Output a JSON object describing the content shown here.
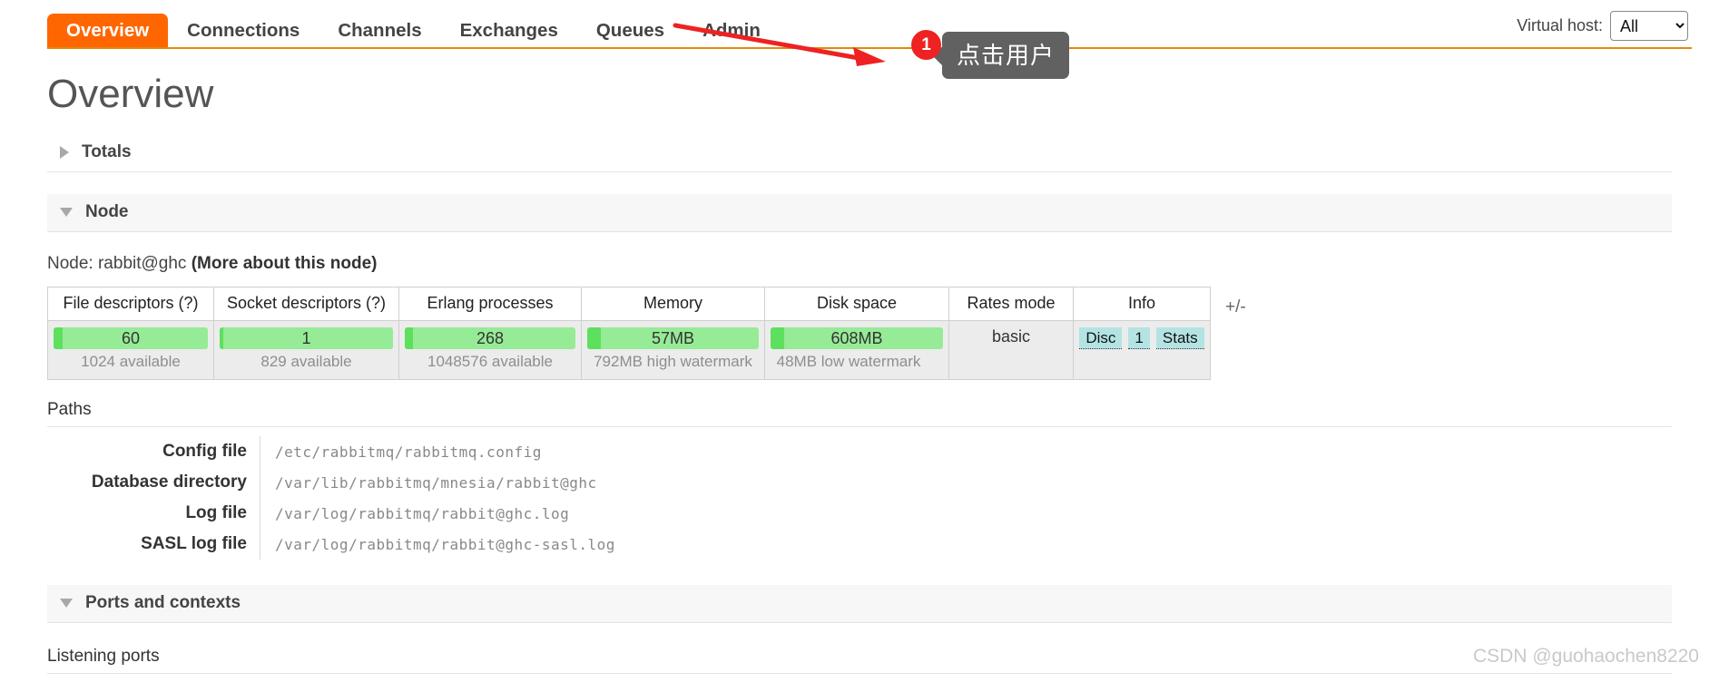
{
  "nav": {
    "tabs": [
      {
        "label": "Overview",
        "active": true
      },
      {
        "label": "Connections",
        "active": false
      },
      {
        "label": "Channels",
        "active": false
      },
      {
        "label": "Exchanges",
        "active": false
      },
      {
        "label": "Queues",
        "active": false
      },
      {
        "label": "Admin",
        "active": false
      }
    ],
    "vhost_label": "Virtual host:",
    "vhost_value": "All",
    "vhost_options": [
      "All",
      "/"
    ]
  },
  "annotation": {
    "badge_number": "1",
    "tooltip_text": "点击用户",
    "arrow_color": "#ee2222",
    "badge_color": "#ee2222",
    "tooltip_bg": "#616161"
  },
  "page": {
    "title": "Overview"
  },
  "sections": {
    "totals": {
      "label": "Totals",
      "expanded": false,
      "icon": "triangle-right-icon"
    },
    "node": {
      "label": "Node",
      "expanded": true,
      "icon": "triangle-down-icon"
    },
    "ports": {
      "label": "Ports and contexts",
      "expanded": true,
      "icon": "triangle-down-icon"
    }
  },
  "node": {
    "prefix": "Node:",
    "name": "rabbit@ghc",
    "more_link": "(More about this node)",
    "toggle_label": "+/-",
    "columns": [
      "File descriptors (?)",
      "Socket descriptors (?)",
      "Erlang processes",
      "Memory",
      "Disk space",
      "Rates mode",
      "Info"
    ],
    "metrics": [
      {
        "name": "file-descriptors",
        "value": "60",
        "sub": "1024 available",
        "fill_pct": 6
      },
      {
        "name": "socket-descriptors",
        "value": "1",
        "sub": "829 available",
        "fill_pct": 2
      },
      {
        "name": "erlang-processes",
        "value": "268",
        "sub": "1048576 available",
        "fill_pct": 5
      },
      {
        "name": "memory",
        "value": "57MB",
        "sub": "792MB high watermark",
        "fill_pct": 8
      },
      {
        "name": "disk-space",
        "value": "608MB",
        "sub": "48MB low watermark",
        "fill_pct": 8
      }
    ],
    "rates_mode": "basic",
    "info_badges": [
      "Disc",
      "1",
      "Stats"
    ],
    "bar_bg_color": "#96eb96",
    "bar_fill_color": "#5de05d",
    "info_badge_color": "#b4e3e3"
  },
  "paths": {
    "heading": "Paths",
    "rows": [
      {
        "label": "Config file",
        "value": "/etc/rabbitmq/rabbitmq.config"
      },
      {
        "label": "Database directory",
        "value": "/var/lib/rabbitmq/mnesia/rabbit@ghc"
      },
      {
        "label": "Log file",
        "value": "/var/log/rabbitmq/rabbit@ghc.log"
      },
      {
        "label": "SASL log file",
        "value": "/var/log/rabbitmq/rabbit@ghc-sasl.log"
      }
    ]
  },
  "ports": {
    "listening_heading": "Listening ports"
  },
  "watermark": {
    "text": "CSDN @guohaochen8220"
  }
}
